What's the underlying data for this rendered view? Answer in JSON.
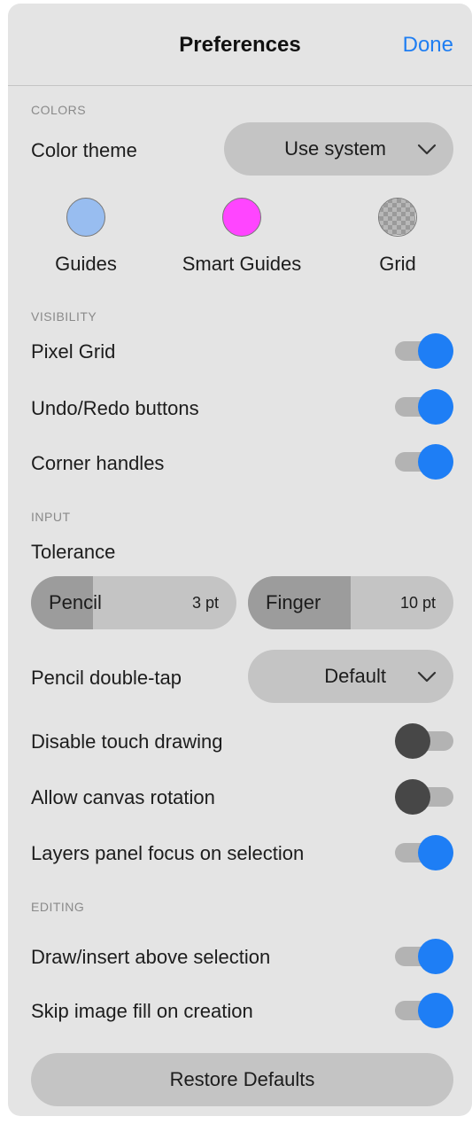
{
  "header": {
    "title": "Preferences",
    "done_label": "Done"
  },
  "colors": {
    "section_label": "COLORS",
    "theme_label": "Color theme",
    "theme_value": "Use system",
    "swatches": [
      {
        "label": "Guides",
        "color": "#98bdf0"
      },
      {
        "label": "Smart Guides",
        "color": "#ff45ff"
      },
      {
        "label": "Grid",
        "color": "checkered"
      }
    ]
  },
  "visibility": {
    "section_label": "VISIBILITY",
    "items": [
      {
        "label": "Pixel Grid",
        "on": true
      },
      {
        "label": "Undo/Redo buttons",
        "on": true
      },
      {
        "label": "Corner handles",
        "on": true
      }
    ]
  },
  "input": {
    "section_label": "INPUT",
    "tolerance_label": "Tolerance",
    "pencil": {
      "label": "Pencil",
      "value": "3 pt",
      "level": 0.3
    },
    "finger": {
      "label": "Finger",
      "value": "10 pt",
      "level": 0.5
    },
    "double_tap_label": "Pencil double-tap",
    "double_tap_value": "Default",
    "toggles": [
      {
        "label": "Disable touch drawing",
        "on": false
      },
      {
        "label": "Allow canvas rotation",
        "on": false
      },
      {
        "label": "Layers panel focus on selection",
        "on": true
      }
    ]
  },
  "editing": {
    "section_label": "EDITING",
    "items": [
      {
        "label": "Draw/insert above selection",
        "on": true
      },
      {
        "label": "Skip image fill on creation",
        "on": true
      }
    ]
  },
  "restore_label": "Restore Defaults",
  "colors_accent": {
    "toggle_on": "#1e7ef5",
    "toggle_off_knob": "#474747",
    "link": "#1f7ef2"
  }
}
